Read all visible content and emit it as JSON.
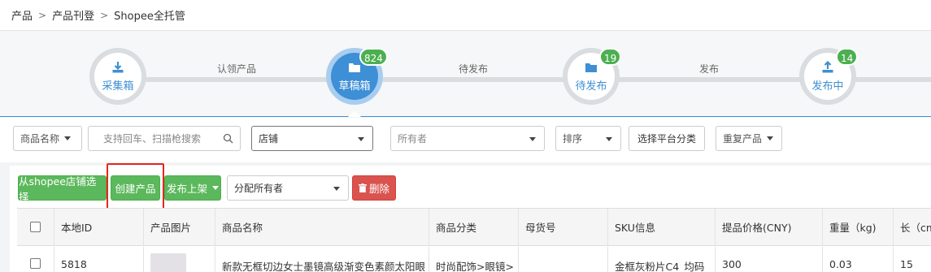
{
  "breadcrumb": [
    "产品",
    "产品刊登",
    "Shopee全托管"
  ],
  "steps": [
    {
      "label": "采集箱",
      "badge": null,
      "icon": "download-icon"
    },
    {
      "label": "草稿箱",
      "badge": "824",
      "icon": "folder-icon",
      "active": true
    },
    {
      "label": "待发布",
      "badge": "19",
      "icon": "folder-icon"
    },
    {
      "label": "发布中",
      "badge": "14",
      "icon": "upload-icon"
    }
  ],
  "step_links": [
    "认领产品",
    "待发布",
    "发布"
  ],
  "filters": {
    "product_name_select": "商品名称",
    "search_placeholder": "支持回车、扫描枪搜索",
    "shop_select": "店铺",
    "owner_select": "所有者",
    "sort_select": "排序",
    "platform_category_button": "选择平台分类",
    "duplicate_select": "重复产品"
  },
  "actions": {
    "select_from_shopee": "从shopee店铺选择",
    "create_product": "创建产品",
    "publish_listing": "发布上架",
    "assign_owner": "分配所有者",
    "delete": "删除"
  },
  "table": {
    "headers": [
      "本地ID",
      "产品图片",
      "商品名称",
      "商品分类",
      "母货号",
      "SKU信息",
      "提品价格(CNY)",
      "重量（kg)",
      "长（cm"
    ],
    "rows": [
      {
        "local_id": "5818",
        "name": "新款无框切边女士墨镜高级渐变色素颜太阳眼",
        "category": "时尚配饰>眼镜>",
        "parent_sku": "",
        "sku_info": "金框灰粉片C4_均码",
        "price": "300",
        "weight": "0.03",
        "length": "15"
      }
    ]
  },
  "colors": {
    "accent": "#3d8fd6",
    "green": "#5cb85c",
    "red": "#d9534f",
    "badge": "#4caf50",
    "highlight": "#e8251f"
  }
}
